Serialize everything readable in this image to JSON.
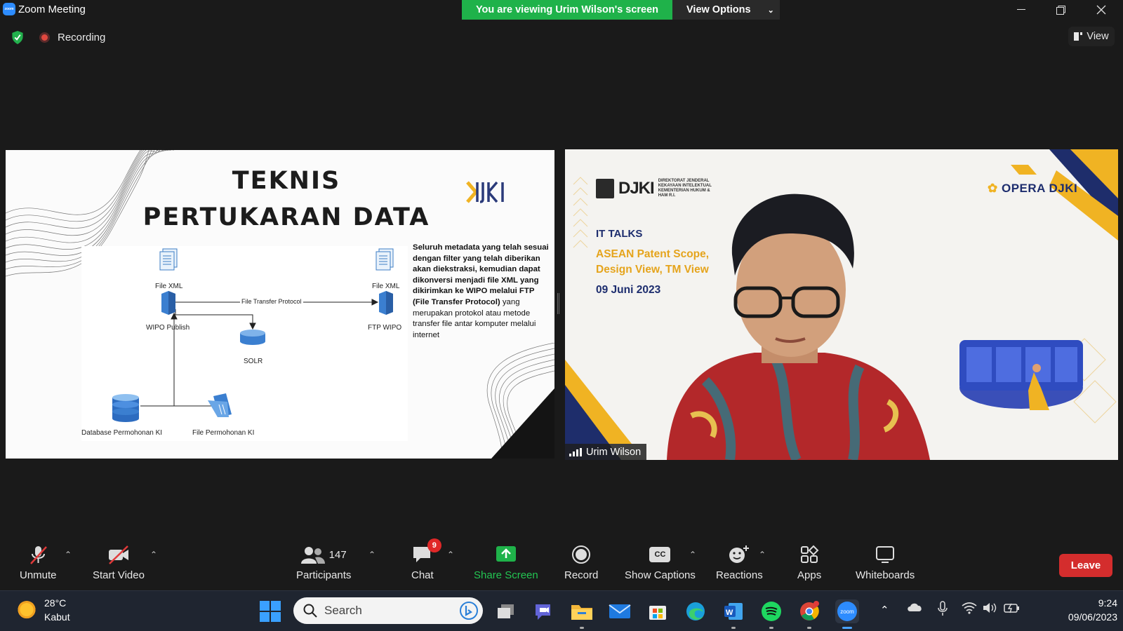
{
  "window": {
    "title": "Zoom Meeting",
    "app_icon_text": "zoom",
    "viewing_banner": "You are viewing Urim Wilson's screen",
    "view_options_label": "View Options"
  },
  "meeting_bar": {
    "recording_label": "Recording",
    "view_label": "View"
  },
  "slide": {
    "title_line1": "TEKNIS",
    "title_line2": "PERTUKARAN DATA",
    "diagram_labels": {
      "file_xml_left": "File XML",
      "file_xml_right": "File XML",
      "wipo_publish": "WIPO Publish",
      "ftp_wipo": "FTP WIPO",
      "ftp_arrow": "File Transfer Protocol",
      "solr": "SOLR",
      "database": "Database Permohonan KI",
      "file_permohonan": "File Permohonan KI"
    },
    "text_bold": "Seluruh metadata yang telah sesuai dengan filter yang telah diberikan akan diekstraksi, kemudian dapat dikonversi menjadi file XML yang dikirimkan ke WIPO melalui FTP (File Transfer Protocol)",
    "text_regular": " yang merupakan protokol atau metode transfer file antar komputer melalui internet"
  },
  "video": {
    "org_name": "DIREKTORAT JENDERAL KEKAYAAN INTELEKTUAL KEMENTERIAN HUKUM & HAM R.I.",
    "org_mark": "DJKI",
    "brand": "OPERA DJKI",
    "series": "IT TALKS",
    "event_title": "ASEAN Patent Scope, Design View, TM View",
    "event_date": "09 Juni 2023",
    "participant_name": "Urim Wilson"
  },
  "toolbar": {
    "unmute": "Unmute",
    "start_video": "Start Video",
    "participants": "Participants",
    "participants_count": "147",
    "chat": "Chat",
    "chat_badge": "9",
    "share_screen": "Share Screen",
    "record": "Record",
    "show_captions": "Show Captions",
    "cc_icon_text": "CC",
    "reactions": "Reactions",
    "apps": "Apps",
    "whiteboards": "Whiteboards",
    "leave": "Leave",
    "share_color": "#1fb24a",
    "leave_color": "#d42d2d"
  },
  "taskbar": {
    "temperature": "28°C",
    "condition": "Kabut",
    "search_placeholder": "Search",
    "zoom_label": "zoom",
    "time": "9:24",
    "date": "09/06/2023"
  }
}
